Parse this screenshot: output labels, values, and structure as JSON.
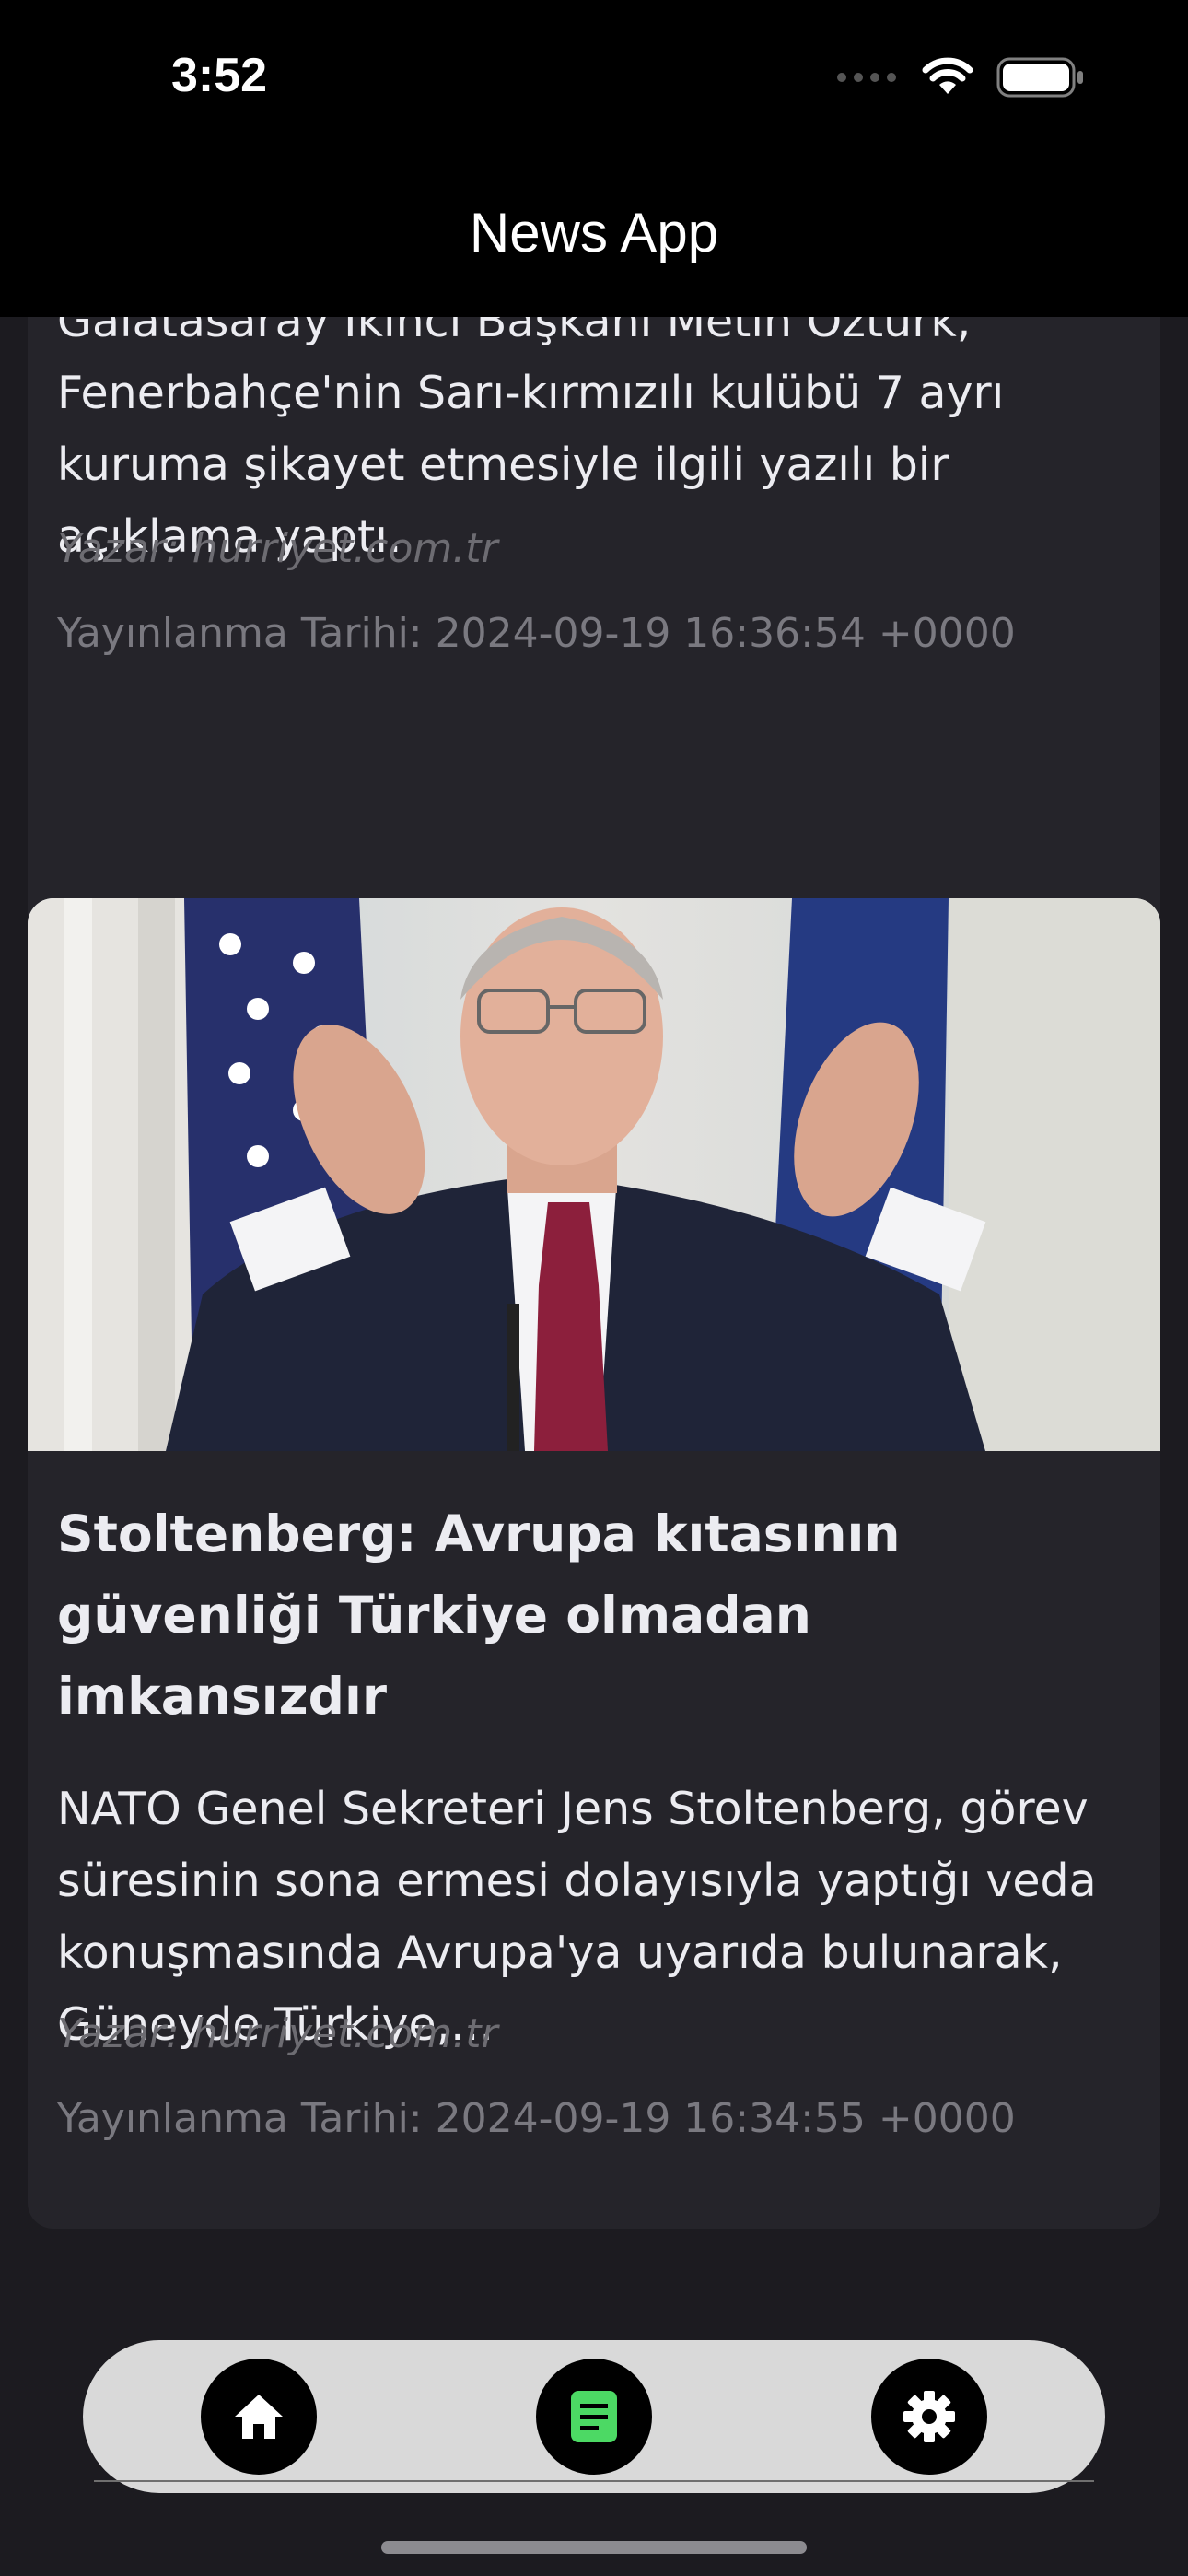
{
  "status_bar": {
    "time": "3:52"
  },
  "nav": {
    "title": "News App"
  },
  "articles": [
    {
      "description": "Galatasaray İkinci Başkanı Metin Öztürk, Fenerbahçe'nin Sarı-kırmızılı kulübü 7 ayrı kuruma şikayet etmesiyle ilgili yazılı bir açıklama yaptı.",
      "author": "Yazar: hurriyet.com.tr",
      "published": "Yayınlanma Tarihi: 2024-09-19 16:36:54 +0000"
    },
    {
      "title": "Stoltenberg: Avrupa kıtasının güvenliği Türkiye olmadan imkansızdır",
      "description": "NATO Genel Sekreteri Jens Stoltenberg, görev süresinin sona ermesi dolayısıyla yaptığı veda konuşmasında Avrupa'ya uyarıda bulunarak, Güneyde Türkiye,...",
      "author": "Yazar: hurriyet.com.tr",
      "published": "Yayınlanma Tarihi: 2024-09-19 16:34:55 +0000"
    }
  ],
  "tabbar": {
    "tabs": [
      {
        "icon": "home-icon"
      },
      {
        "icon": "news-document-icon",
        "accent": "#4cd964"
      },
      {
        "icon": "gear-icon"
      }
    ]
  }
}
